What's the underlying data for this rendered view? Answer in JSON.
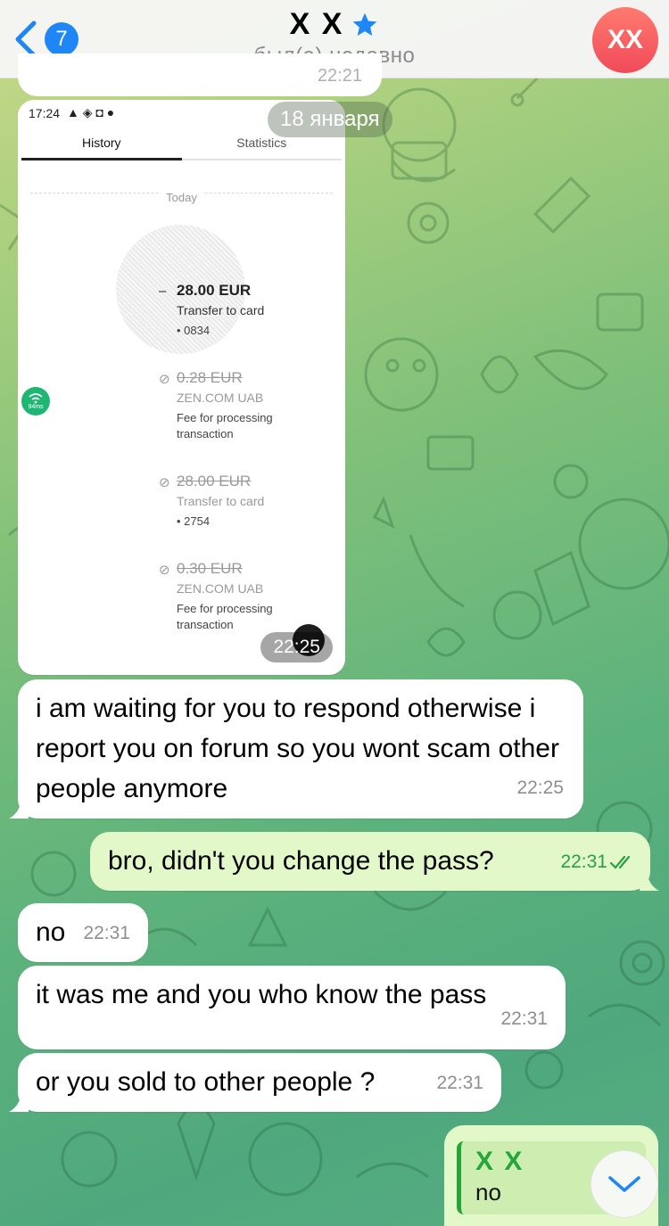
{
  "header": {
    "back_count": "7",
    "title": "X X",
    "status": "был(а) недавно",
    "avatar_initials": "XX"
  },
  "partial_message": {
    "time": "22:21"
  },
  "date_separator": "18 января",
  "image_message": {
    "time": "22:25",
    "screenshot": {
      "status_time": "17:24",
      "tabs": [
        "History",
        "Statistics"
      ],
      "today_label": "Today",
      "ping_label": "94ms",
      "transactions": [
        {
          "amount": "28.00 EUR",
          "title": "Transfer to card",
          "detail": "• 0834",
          "struck": false
        },
        {
          "amount": "0.28 EUR",
          "title": "ZEN.COM UAB",
          "detail": "Fee for processing transaction",
          "struck": true
        },
        {
          "amount": "28.00 EUR",
          "title": "Transfer to card",
          "detail": "• 2754",
          "struck": true
        },
        {
          "amount": "0.30 EUR",
          "title": "ZEN.COM UAB",
          "detail": "Fee for processing transaction",
          "struck": true
        }
      ]
    }
  },
  "messages": [
    {
      "direction": "in",
      "text": "i am waiting for you to respond otherwise i report you on forum so you wont scam other people anymore",
      "time": "22:25"
    },
    {
      "direction": "out",
      "text": "bro, didn't you change the pass?",
      "time": "22:31",
      "read": true
    },
    {
      "direction": "in",
      "text": "no",
      "time": "22:31"
    },
    {
      "direction": "in",
      "text": "it was me and you who know the pass",
      "time": "22:31"
    },
    {
      "direction": "in",
      "text": "or you sold to other people ?",
      "time": "22:31"
    }
  ],
  "reply_preview": {
    "name": "X X",
    "text": "no"
  },
  "colors": {
    "accent": "#1e86f5",
    "outgoing_bubble": "#e2f8c8",
    "outgoing_time": "#2ba043",
    "avatar": "#f14a5a"
  },
  "icons": {
    "back": "chevron-left-icon",
    "verified": "star-icon",
    "read": "double-check-icon",
    "scroll": "chevron-down-icon"
  }
}
